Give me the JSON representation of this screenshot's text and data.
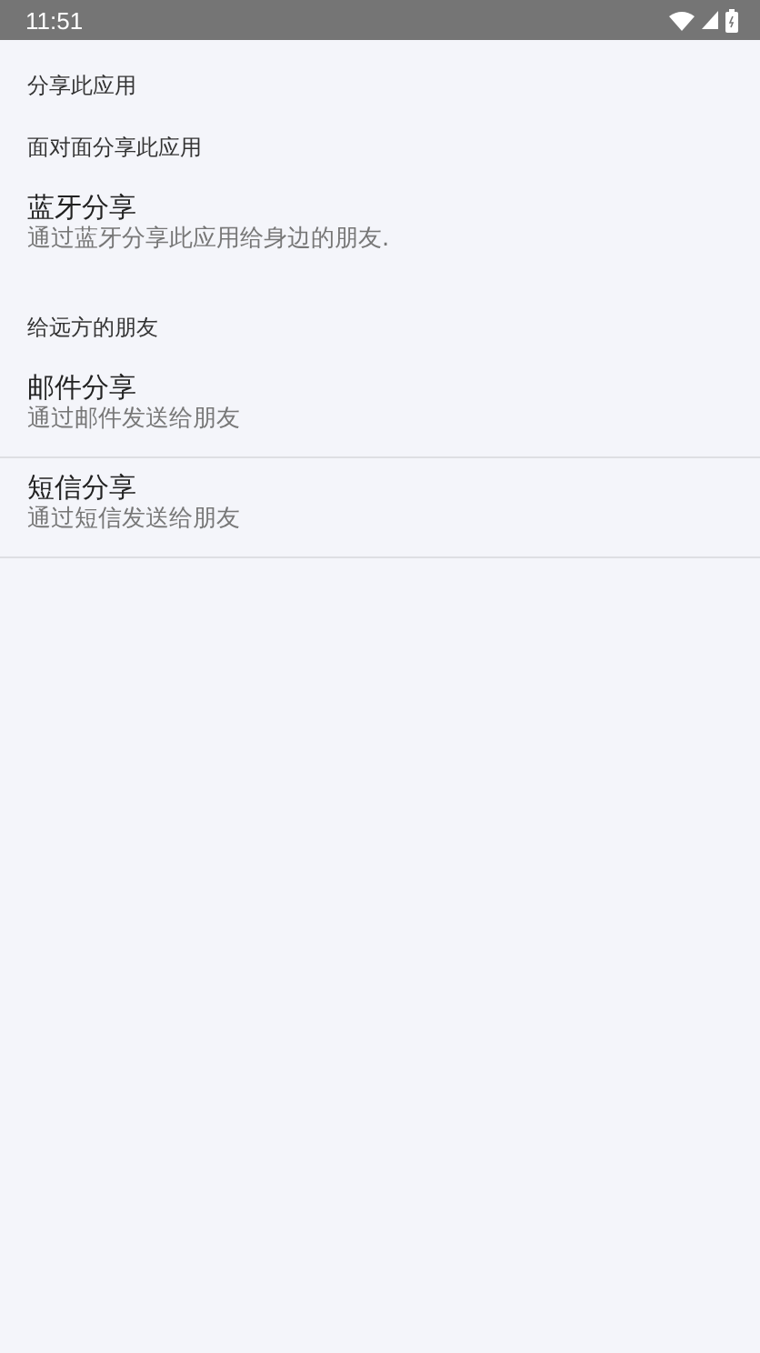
{
  "status_bar": {
    "time": "11:51"
  },
  "page_title": "分享此应用",
  "sections": [
    {
      "title": "面对面分享此应用",
      "items": [
        {
          "title": "蓝牙分享",
          "subtitle": "通过蓝牙分享此应用给身边的朋友.",
          "divider": false
        }
      ]
    },
    {
      "title": "给远方的朋友",
      "items": [
        {
          "title": "邮件分享",
          "subtitle": "通过邮件发送给朋友",
          "divider": true
        },
        {
          "title": "短信分享",
          "subtitle": "通过短信发送给朋友",
          "divider": true
        }
      ]
    }
  ]
}
